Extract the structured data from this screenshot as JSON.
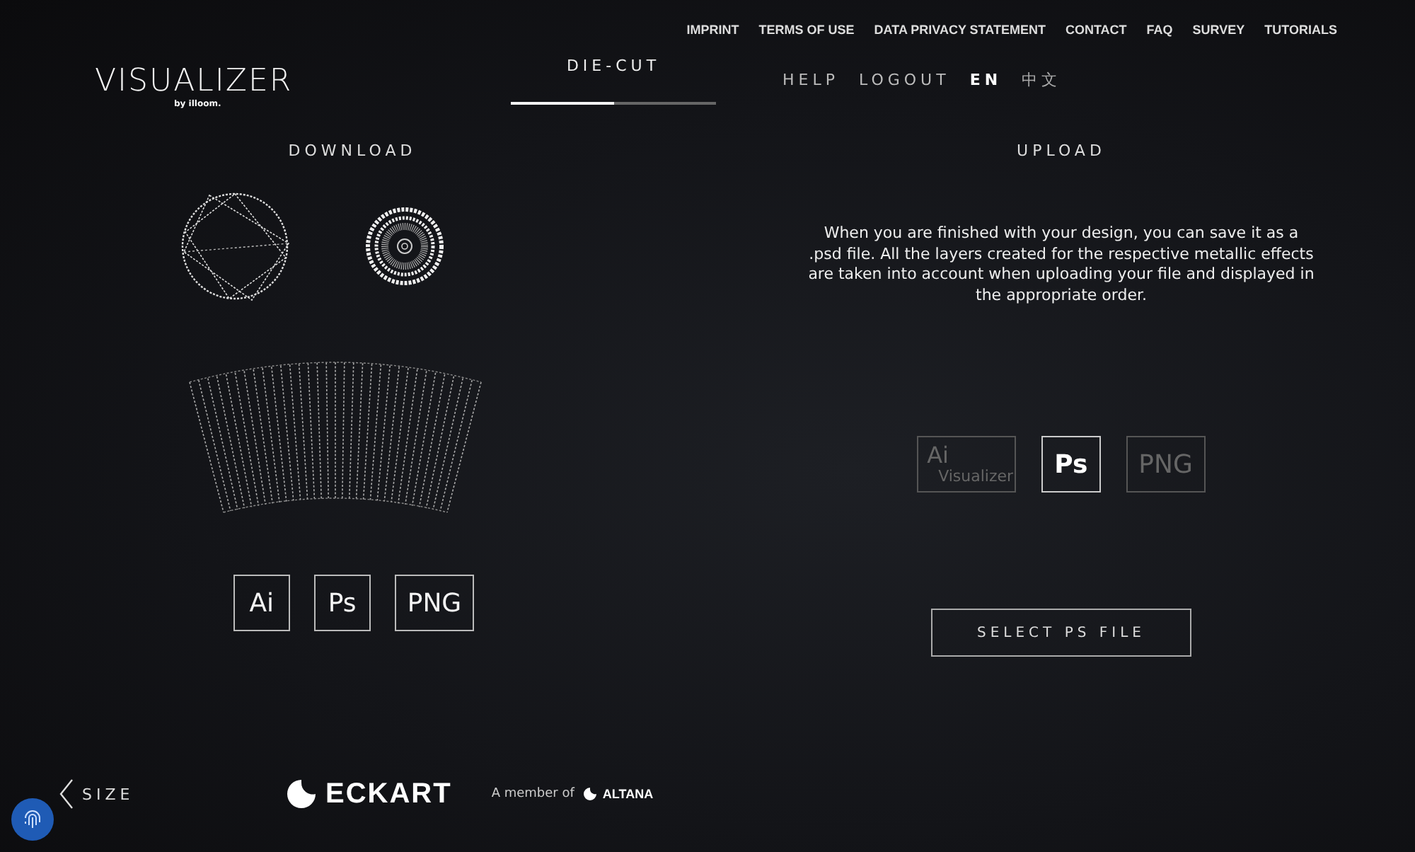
{
  "top_links": [
    "IMPRINT",
    "TERMS OF USE",
    "DATA PRIVACY STATEMENT",
    "CONTACT",
    "FAQ",
    "SURVEY",
    "TUTORIALS"
  ],
  "logo": {
    "text": "VISUALIZER",
    "byline": "by illoom."
  },
  "step": {
    "label": "DIE-CUT",
    "level": 0.5
  },
  "account_links": [
    "HELP",
    "LOGOUT"
  ],
  "languages": [
    {
      "label": "EN",
      "selected": true
    },
    {
      "label": "中文",
      "selected": false
    }
  ],
  "download": {
    "title": "DOWNLOAD",
    "formats": [
      {
        "label": "Ai"
      },
      {
        "label": "Ps"
      },
      {
        "label": "PNG"
      }
    ]
  },
  "upload": {
    "title": "UPLOAD",
    "description": "When you are finished with your design, you can save it as a .psd file. All the layers created for the respective metallic effects are taken into account when uploading your file and displayed in the appropriate order.",
    "formats": [
      {
        "label": "Ai",
        "sublabel": "Visualizer",
        "selected": false
      },
      {
        "label": "Ps",
        "selected": true
      },
      {
        "label": "PNG",
        "selected": false
      }
    ],
    "button": "SELECT PS FILE"
  },
  "footer": {
    "back": "SIZE",
    "brand": "ECKART",
    "member_text": "A member of",
    "parent_brand": "ALTANA"
  }
}
